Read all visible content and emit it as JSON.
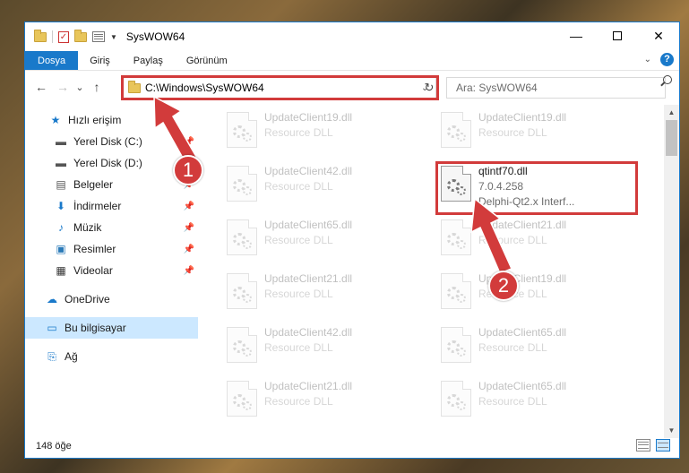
{
  "window": {
    "title": "SysWOW64",
    "minimize": "—",
    "close": "✕"
  },
  "menu": {
    "tabs": [
      "Dosya",
      "Giriş",
      "Paylaş",
      "Görünüm"
    ],
    "help": "?"
  },
  "nav": {
    "back": "←",
    "forward": "→",
    "recent": "⌄",
    "up": "↑",
    "address": "C:\\Windows\\SysWOW64",
    "refresh": "↻"
  },
  "search": {
    "placeholder": "Ara: SysWOW64"
  },
  "sidebar": {
    "items": [
      {
        "label": "Hızlı erişim",
        "icon": "star-icon"
      },
      {
        "label": "Yerel Disk (C:)",
        "icon": "drive-icon"
      },
      {
        "label": "Yerel Disk (D:)",
        "icon": "drive-icon"
      },
      {
        "label": "Belgeler",
        "icon": "document-icon"
      },
      {
        "label": "İndirmeler",
        "icon": "download-icon"
      },
      {
        "label": "Müzik",
        "icon": "music-icon"
      },
      {
        "label": "Resimler",
        "icon": "pictures-icon"
      },
      {
        "label": "Videolar",
        "icon": "video-icon"
      },
      {
        "label": "OneDrive",
        "icon": "cloud-icon"
      },
      {
        "label": "Bu bilgisayar",
        "icon": "computer-icon"
      },
      {
        "label": "Ağ",
        "icon": "network-icon"
      }
    ]
  },
  "files": [
    {
      "name": "UpdateClient19.dll",
      "desc": "Resource DLL"
    },
    {
      "name": "UpdateClient19.dll",
      "desc": "Resource DLL"
    },
    {
      "name": "UpdateClient42.dll",
      "desc": "Resource DLL"
    },
    {
      "name": "qtintf70.dll",
      "desc": "7.0.4.258",
      "desc2": "Delphi-Qt2.x Interf..."
    },
    {
      "name": "UpdateClient65.dll",
      "desc": "Resource DLL"
    },
    {
      "name": "UpdateClient21.dll",
      "desc": "Resource DLL"
    },
    {
      "name": "UpdateClient21.dll",
      "desc": "Resource DLL"
    },
    {
      "name": "UpdateClient19.dll",
      "desc": "Resource DLL"
    },
    {
      "name": "UpdateClient42.dll",
      "desc": "Resource DLL"
    },
    {
      "name": "UpdateClient65.dll",
      "desc": "Resource DLL"
    },
    {
      "name": "UpdateClient21.dll",
      "desc": "Resource DLL"
    },
    {
      "name": "UpdateClient65.dll",
      "desc": "Resource DLL"
    }
  ],
  "status": {
    "count": "148 öğe"
  },
  "callouts": [
    "1",
    "2"
  ],
  "colors": {
    "accent": "#1979ca",
    "highlight": "#d23b3b",
    "selected": "#cce8ff"
  }
}
